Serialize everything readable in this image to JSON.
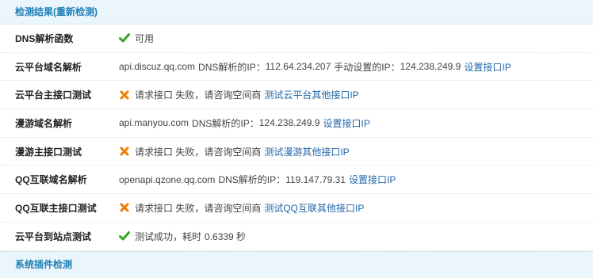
{
  "colors": {
    "header_bg": "#eaf5fc",
    "header_text": "#1a7fb5",
    "link": "#2366a8",
    "success": "#39a627",
    "fail": "#f07b00"
  },
  "header": {
    "title": "检测结果(重新检测)"
  },
  "rows": [
    {
      "label": "DNS解析函数",
      "status_icon": "check-icon",
      "text": "可用"
    },
    {
      "label": "云平台域名解析",
      "domain": "api.discuz.qq.com",
      "dns_label": "DNS解析的IP：",
      "dns_ip": "112.64.234.207",
      "manual_label": "手动设置的IP：",
      "manual_ip": "124.238.249.9",
      "link": "设置接口IP"
    },
    {
      "label": "云平台主接口测试",
      "status_icon": "cross-icon",
      "text": "请求接口 失败，请咨询空间商",
      "link": "测试云平台其他接口IP"
    },
    {
      "label": "漫游域名解析",
      "domain": "api.manyou.com",
      "dns_label": "DNS解析的IP：",
      "dns_ip": "124.238.249.9",
      "link": "设置接口IP"
    },
    {
      "label": "漫游主接口测试",
      "status_icon": "cross-icon",
      "text": "请求接口 失败，请咨询空间商",
      "link": "测试漫游其他接口IP"
    },
    {
      "label": "QQ互联域名解析",
      "domain": "openapi.qzone.qq.com",
      "dns_label": "DNS解析的IP：",
      "dns_ip": "119.147.79.31",
      "link": "设置接口IP"
    },
    {
      "label": "QQ互联主接口测试",
      "status_icon": "cross-icon",
      "text": "请求接口 失败，请咨询空间商",
      "link": "测试QQ互联其他接口IP"
    },
    {
      "label": "云平台到站点测试",
      "status_icon": "check-icon",
      "text": "测试成功，耗时",
      "time": "0.6339 秒"
    }
  ],
  "footer_header": {
    "title": "系统插件检测"
  }
}
